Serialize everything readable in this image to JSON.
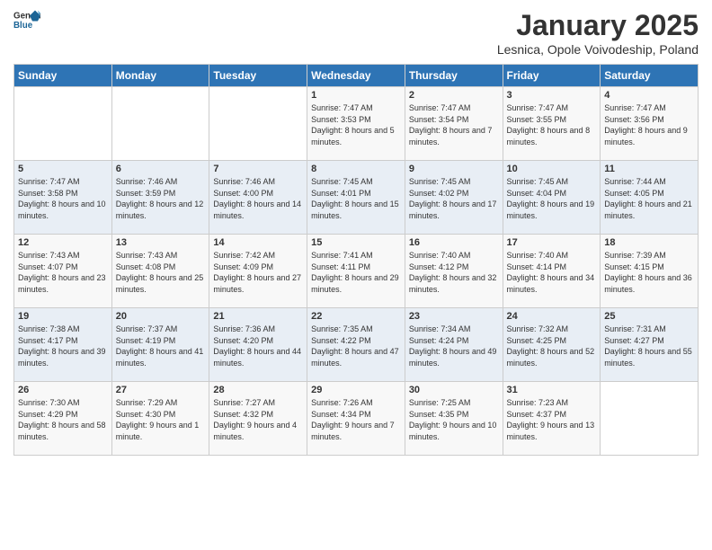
{
  "header": {
    "logo_general": "General",
    "logo_blue": "Blue",
    "month_title": "January 2025",
    "subtitle": "Lesnica, Opole Voivodeship, Poland"
  },
  "days_of_week": [
    "Sunday",
    "Monday",
    "Tuesday",
    "Wednesday",
    "Thursday",
    "Friday",
    "Saturday"
  ],
  "weeks": [
    [
      {
        "day": "",
        "sunrise": "",
        "sunset": "",
        "daylight": ""
      },
      {
        "day": "",
        "sunrise": "",
        "sunset": "",
        "daylight": ""
      },
      {
        "day": "",
        "sunrise": "",
        "sunset": "",
        "daylight": ""
      },
      {
        "day": "1",
        "sunrise": "Sunrise: 7:47 AM",
        "sunset": "Sunset: 3:53 PM",
        "daylight": "Daylight: 8 hours and 5 minutes."
      },
      {
        "day": "2",
        "sunrise": "Sunrise: 7:47 AM",
        "sunset": "Sunset: 3:54 PM",
        "daylight": "Daylight: 8 hours and 7 minutes."
      },
      {
        "day": "3",
        "sunrise": "Sunrise: 7:47 AM",
        "sunset": "Sunset: 3:55 PM",
        "daylight": "Daylight: 8 hours and 8 minutes."
      },
      {
        "day": "4",
        "sunrise": "Sunrise: 7:47 AM",
        "sunset": "Sunset: 3:56 PM",
        "daylight": "Daylight: 8 hours and 9 minutes."
      }
    ],
    [
      {
        "day": "5",
        "sunrise": "Sunrise: 7:47 AM",
        "sunset": "Sunset: 3:58 PM",
        "daylight": "Daylight: 8 hours and 10 minutes."
      },
      {
        "day": "6",
        "sunrise": "Sunrise: 7:46 AM",
        "sunset": "Sunset: 3:59 PM",
        "daylight": "Daylight: 8 hours and 12 minutes."
      },
      {
        "day": "7",
        "sunrise": "Sunrise: 7:46 AM",
        "sunset": "Sunset: 4:00 PM",
        "daylight": "Daylight: 8 hours and 14 minutes."
      },
      {
        "day": "8",
        "sunrise": "Sunrise: 7:45 AM",
        "sunset": "Sunset: 4:01 PM",
        "daylight": "Daylight: 8 hours and 15 minutes."
      },
      {
        "day": "9",
        "sunrise": "Sunrise: 7:45 AM",
        "sunset": "Sunset: 4:02 PM",
        "daylight": "Daylight: 8 hours and 17 minutes."
      },
      {
        "day": "10",
        "sunrise": "Sunrise: 7:45 AM",
        "sunset": "Sunset: 4:04 PM",
        "daylight": "Daylight: 8 hours and 19 minutes."
      },
      {
        "day": "11",
        "sunrise": "Sunrise: 7:44 AM",
        "sunset": "Sunset: 4:05 PM",
        "daylight": "Daylight: 8 hours and 21 minutes."
      }
    ],
    [
      {
        "day": "12",
        "sunrise": "Sunrise: 7:43 AM",
        "sunset": "Sunset: 4:07 PM",
        "daylight": "Daylight: 8 hours and 23 minutes."
      },
      {
        "day": "13",
        "sunrise": "Sunrise: 7:43 AM",
        "sunset": "Sunset: 4:08 PM",
        "daylight": "Daylight: 8 hours and 25 minutes."
      },
      {
        "day": "14",
        "sunrise": "Sunrise: 7:42 AM",
        "sunset": "Sunset: 4:09 PM",
        "daylight": "Daylight: 8 hours and 27 minutes."
      },
      {
        "day": "15",
        "sunrise": "Sunrise: 7:41 AM",
        "sunset": "Sunset: 4:11 PM",
        "daylight": "Daylight: 8 hours and 29 minutes."
      },
      {
        "day": "16",
        "sunrise": "Sunrise: 7:40 AM",
        "sunset": "Sunset: 4:12 PM",
        "daylight": "Daylight: 8 hours and 32 minutes."
      },
      {
        "day": "17",
        "sunrise": "Sunrise: 7:40 AM",
        "sunset": "Sunset: 4:14 PM",
        "daylight": "Daylight: 8 hours and 34 minutes."
      },
      {
        "day": "18",
        "sunrise": "Sunrise: 7:39 AM",
        "sunset": "Sunset: 4:15 PM",
        "daylight": "Daylight: 8 hours and 36 minutes."
      }
    ],
    [
      {
        "day": "19",
        "sunrise": "Sunrise: 7:38 AM",
        "sunset": "Sunset: 4:17 PM",
        "daylight": "Daylight: 8 hours and 39 minutes."
      },
      {
        "day": "20",
        "sunrise": "Sunrise: 7:37 AM",
        "sunset": "Sunset: 4:19 PM",
        "daylight": "Daylight: 8 hours and 41 minutes."
      },
      {
        "day": "21",
        "sunrise": "Sunrise: 7:36 AM",
        "sunset": "Sunset: 4:20 PM",
        "daylight": "Daylight: 8 hours and 44 minutes."
      },
      {
        "day": "22",
        "sunrise": "Sunrise: 7:35 AM",
        "sunset": "Sunset: 4:22 PM",
        "daylight": "Daylight: 8 hours and 47 minutes."
      },
      {
        "day": "23",
        "sunrise": "Sunrise: 7:34 AM",
        "sunset": "Sunset: 4:24 PM",
        "daylight": "Daylight: 8 hours and 49 minutes."
      },
      {
        "day": "24",
        "sunrise": "Sunrise: 7:32 AM",
        "sunset": "Sunset: 4:25 PM",
        "daylight": "Daylight: 8 hours and 52 minutes."
      },
      {
        "day": "25",
        "sunrise": "Sunrise: 7:31 AM",
        "sunset": "Sunset: 4:27 PM",
        "daylight": "Daylight: 8 hours and 55 minutes."
      }
    ],
    [
      {
        "day": "26",
        "sunrise": "Sunrise: 7:30 AM",
        "sunset": "Sunset: 4:29 PM",
        "daylight": "Daylight: 8 hours and 58 minutes."
      },
      {
        "day": "27",
        "sunrise": "Sunrise: 7:29 AM",
        "sunset": "Sunset: 4:30 PM",
        "daylight": "Daylight: 9 hours and 1 minute."
      },
      {
        "day": "28",
        "sunrise": "Sunrise: 7:27 AM",
        "sunset": "Sunset: 4:32 PM",
        "daylight": "Daylight: 9 hours and 4 minutes."
      },
      {
        "day": "29",
        "sunrise": "Sunrise: 7:26 AM",
        "sunset": "Sunset: 4:34 PM",
        "daylight": "Daylight: 9 hours and 7 minutes."
      },
      {
        "day": "30",
        "sunrise": "Sunrise: 7:25 AM",
        "sunset": "Sunset: 4:35 PM",
        "daylight": "Daylight: 9 hours and 10 minutes."
      },
      {
        "day": "31",
        "sunrise": "Sunrise: 7:23 AM",
        "sunset": "Sunset: 4:37 PM",
        "daylight": "Daylight: 9 hours and 13 minutes."
      },
      {
        "day": "",
        "sunrise": "",
        "sunset": "",
        "daylight": ""
      }
    ]
  ]
}
